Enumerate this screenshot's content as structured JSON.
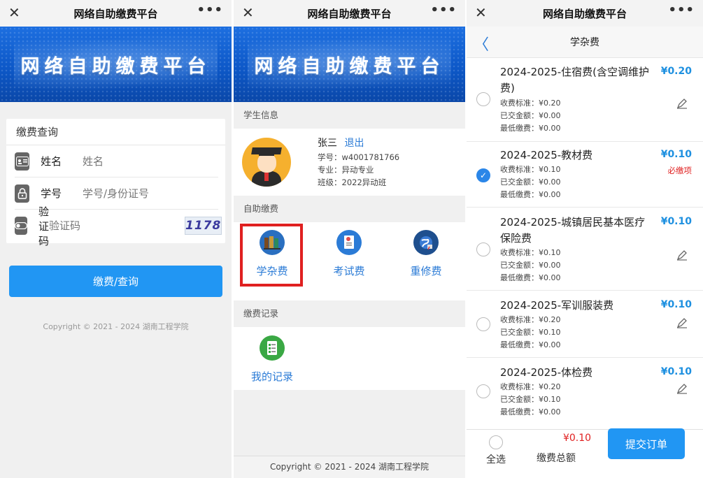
{
  "common": {
    "title": "网络自助缴费平台",
    "banner_text": "网络自助缴费平台",
    "close_glyph": "✕",
    "more_glyph": "•••"
  },
  "login": {
    "card_title": "缴费查询",
    "fields": [
      {
        "label": "姓名",
        "placeholder": "姓名",
        "icon": "id-card-icon"
      },
      {
        "label": "学号",
        "placeholder": "学号/身份证号",
        "icon": "lock-icon"
      },
      {
        "label": "验证码",
        "placeholder": "验证码",
        "icon": "toggle-icon",
        "captcha": "1178"
      }
    ],
    "submit_label": "缴费/查询",
    "copyright": "Copyright © 2021 - 2024 湖南工程学院"
  },
  "home": {
    "student_section": "学生信息",
    "student": {
      "name": "张三",
      "logout": "退出",
      "id_line": "学号：w4001781766",
      "major_line": "专业：异动专业",
      "class_line": "班级：2022异动班"
    },
    "self_pay_section": "自助缴费",
    "pay_items": [
      {
        "label": "学杂费",
        "icon": "books-icon",
        "highlighted": true
      },
      {
        "label": "考试费",
        "icon": "exam-paper-icon",
        "highlighted": false
      },
      {
        "label": "重修费",
        "icon": "globe-icon",
        "highlighted": false
      }
    ],
    "records_section": "缴费记录",
    "records_item": {
      "label": "我的记录",
      "icon": "checklist-icon"
    },
    "copyright": "Copyright © 2021 - 2024 湖南工程学院"
  },
  "fees": {
    "page_title": "学杂费",
    "back_glyph": "〈",
    "items": [
      {
        "name": "2024-2025-住宿费(含空调维护费)",
        "standard": "收费标准：¥0.20",
        "paid": "已交金额：¥0.00",
        "min": "最低缴费：¥0.00",
        "amount": "¥0.20",
        "checked": false,
        "tag": ""
      },
      {
        "name": "2024-2025-教材费",
        "standard": "收费标准：¥0.10",
        "paid": "已交金额：¥0.00",
        "min": "最低缴费：¥0.00",
        "amount": "¥0.10",
        "checked": true,
        "tag": "必缴项"
      },
      {
        "name": "2024-2025-城镇居民基本医疗保险费",
        "standard": "收费标准：¥0.10",
        "paid": "已交金额：¥0.00",
        "min": "最低缴费：¥0.00",
        "amount": "¥0.10",
        "checked": false,
        "tag": ""
      },
      {
        "name": "2024-2025-军训服装费",
        "standard": "收费标准：¥0.20",
        "paid": "已交金额：¥0.10",
        "min": "最低缴费：¥0.00",
        "amount": "¥0.10",
        "checked": false,
        "tag": ""
      },
      {
        "name": "2024-2025-体检费",
        "standard": "收费标准：¥0.20",
        "paid": "已交金额：¥0.10",
        "min": "最低缴费：¥0.00",
        "amount": "¥0.10",
        "checked": false,
        "tag": ""
      }
    ],
    "select_all": "全选",
    "total_amount": "¥0.10",
    "total_label": "缴费总额",
    "submit_label": "提交订单"
  },
  "colors": {
    "accent": "#2196f3",
    "link": "#2b7bd6",
    "danger": "#e02020"
  }
}
